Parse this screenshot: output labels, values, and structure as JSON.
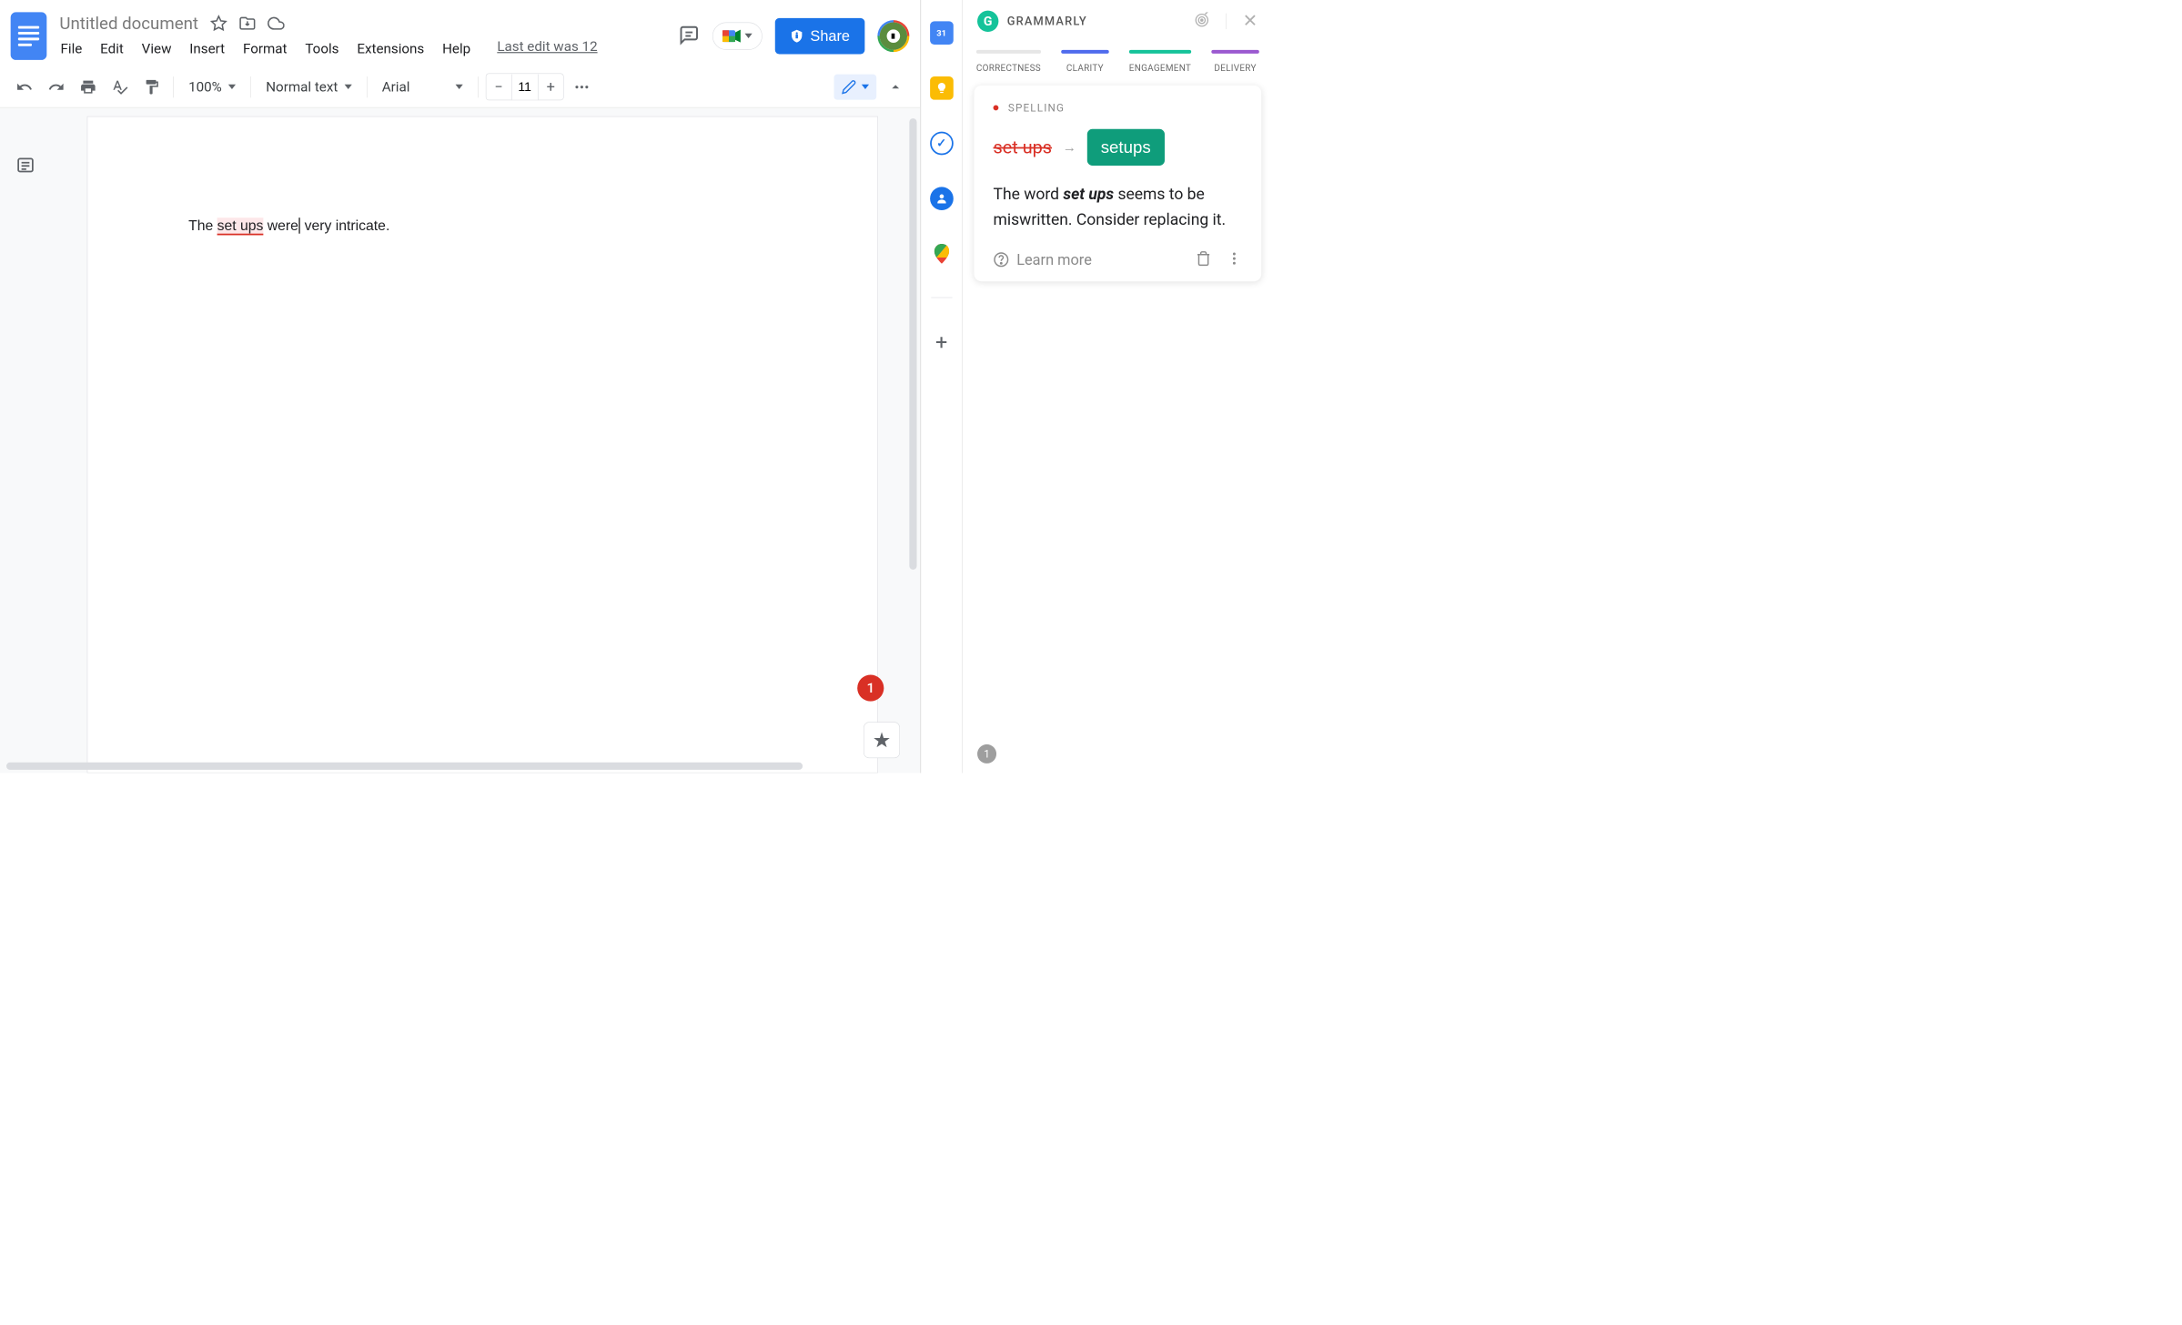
{
  "doc": {
    "title": "Untitled document",
    "last_edit": "Last edit was 12"
  },
  "menubar": [
    "File",
    "Edit",
    "View",
    "Insert",
    "Format",
    "Tools",
    "Extensions",
    "Help"
  ],
  "toolbar": {
    "zoom": "100%",
    "style": "Normal text",
    "font": "Arial",
    "font_size": "11"
  },
  "share_label": "Share",
  "document_text": {
    "before": "The ",
    "error": "set ups",
    "mid": " were",
    "after": " very intricate."
  },
  "error_count": "1",
  "grammarly": {
    "brand": "GRAMMARLY",
    "tabs": [
      {
        "label": "CORRECTNESS",
        "color": "#e6e6e6"
      },
      {
        "label": "CLARITY",
        "color": "#4f6bed"
      },
      {
        "label": "ENGAGEMENT",
        "color": "#15c39a"
      },
      {
        "label": "DELIVERY",
        "color": "#9b59d0"
      }
    ],
    "card": {
      "category": "SPELLING",
      "wrong": "set ups",
      "fix": "setups",
      "explain_pre": "The word ",
      "explain_bold": "set ups",
      "explain_post": " seems to be miswritten. Consider replacing it.",
      "learn_more": "Learn more"
    },
    "bottom_count": "1"
  },
  "side_rail": {
    "calendar_day": "31"
  }
}
